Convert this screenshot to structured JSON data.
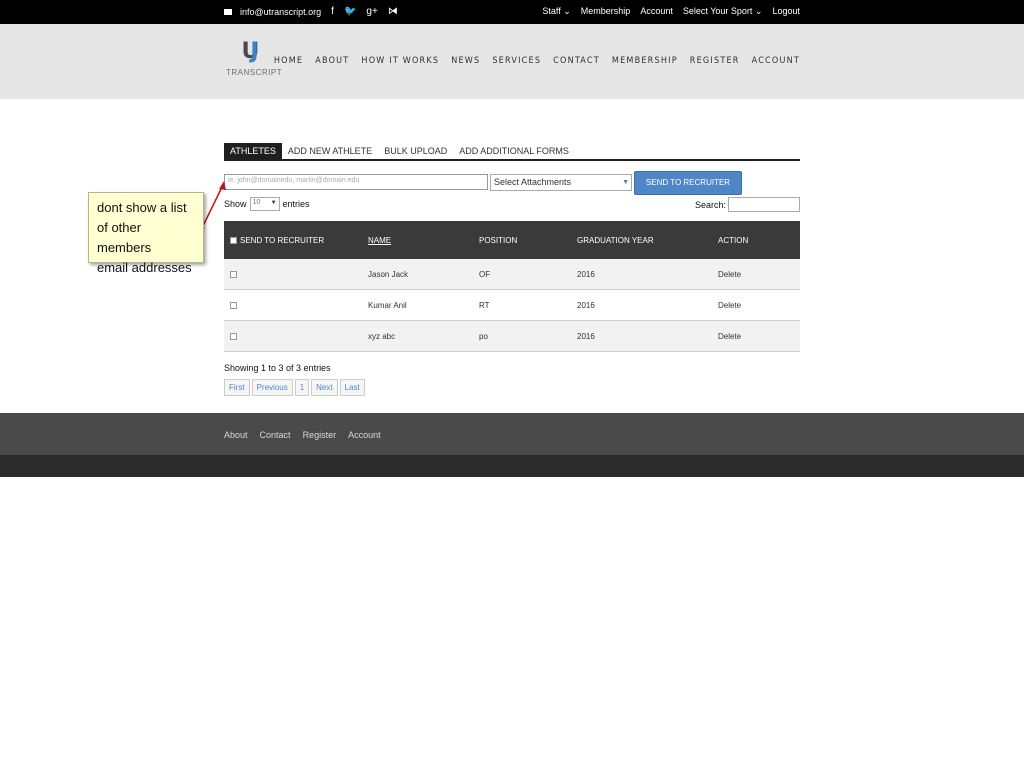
{
  "topbar": {
    "email": "info@utranscript.org",
    "social_icons": [
      "facebook-icon",
      "twitter-icon",
      "google-plus-icon",
      "rss-icon"
    ],
    "links": [
      {
        "label": "Staff",
        "dropdown": true
      },
      {
        "label": "Membership",
        "dropdown": false
      },
      {
        "label": "Account",
        "dropdown": false
      },
      {
        "label": "Select Your Sport",
        "dropdown": true
      },
      {
        "label": "Logout",
        "dropdown": false
      }
    ]
  },
  "logo": {
    "mark_a": "U",
    "mark_b": "J",
    "word": "TRANSCRIPT"
  },
  "nav": [
    "HOME",
    "ABOUT",
    "HOW IT WORKS",
    "NEWS",
    "SERVICES",
    "CONTACT",
    "MEMBERSHIP",
    "REGISTER",
    "ACCOUNT"
  ],
  "tabs": [
    {
      "label": "ATHLETES",
      "active": true
    },
    {
      "label": "ADD NEW ATHLETE",
      "active": false
    },
    {
      "label": "BULK UPLOAD",
      "active": false
    },
    {
      "label": "ADD ADDITIONAL FORMS",
      "active": false
    }
  ],
  "recruiter_form": {
    "email_placeholder": "ie. john@domainedu, martin@domain.edu",
    "attachments_value": "Select Attachments",
    "send_label": "SEND TO RECRUITER"
  },
  "table_controls": {
    "show_label": "Show",
    "entries_value": "10",
    "entries_label": "entries",
    "search_label": "Search:"
  },
  "table": {
    "headers": [
      "SEND TO RECRUITER",
      "NAME",
      "POSITION",
      "GRADUATION YEAR",
      "ACTION"
    ],
    "rows": [
      [
        "",
        "Jason Jack",
        "OF",
        "2016",
        "Delete"
      ],
      [
        "",
        "Kumar Anil",
        "RT",
        "2016",
        "Delete"
      ],
      [
        "",
        "xyz abc",
        "po",
        "2016",
        "Delete"
      ]
    ]
  },
  "table_info": "Showing 1 to 3 of 3 entries",
  "pager": [
    "First",
    "Previous",
    "1",
    "Next",
    "Last"
  ],
  "footer_links": [
    "About",
    "Contact",
    "Register",
    "Account"
  ],
  "annotation": {
    "lines": [
      "dont show a list",
      "of other members",
      "email addresses"
    ],
    "arrow_color": "#c0141a"
  },
  "colors": {
    "accent": "#4f86c6",
    "top_bar": "#000000",
    "header": "#e6e6e6",
    "table_header": "#3a3a3a",
    "footer": "#4a4a4a",
    "note_bg": "#ffffd2"
  }
}
